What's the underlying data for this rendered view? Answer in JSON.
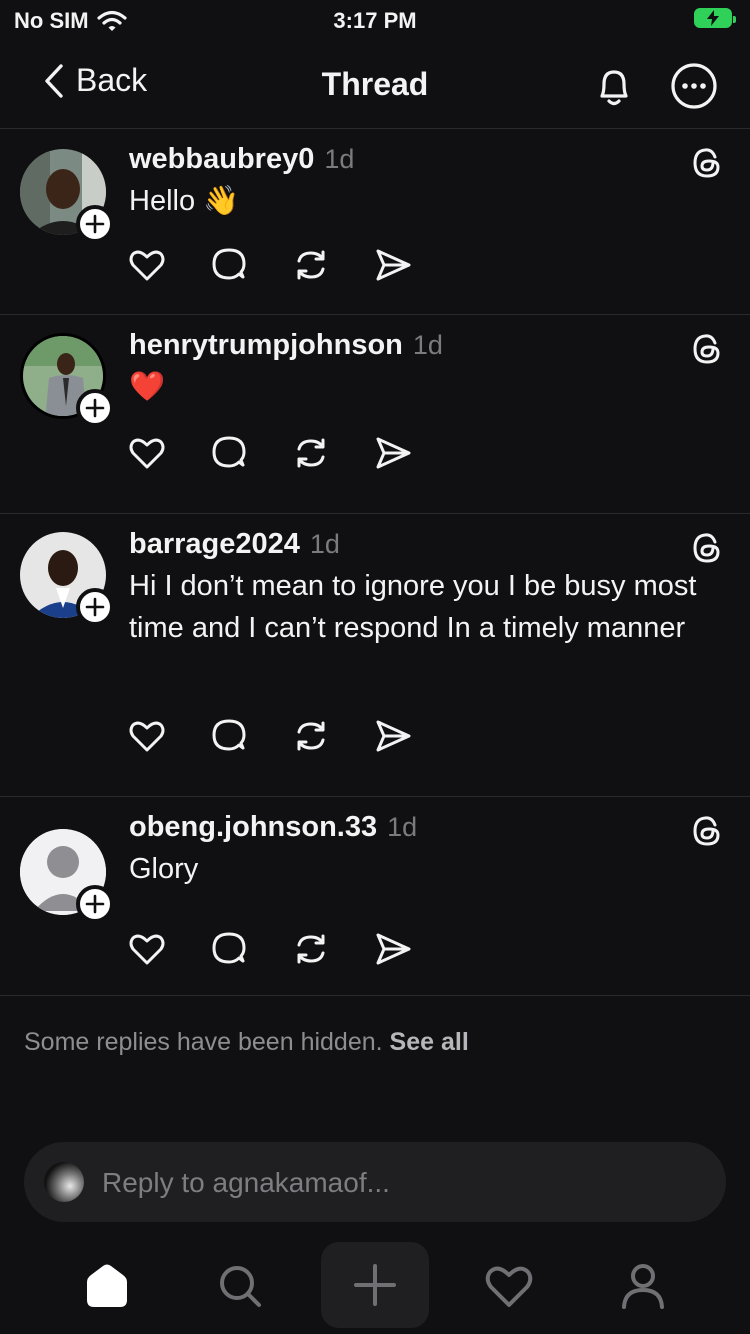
{
  "status_bar": {
    "carrier": "No SIM",
    "time": "3:17 PM"
  },
  "nav": {
    "back_label": "Back",
    "title": "Thread"
  },
  "replies": [
    {
      "username": "webbaubrey0",
      "time": "1d",
      "text": "Hello 👋"
    },
    {
      "username": "henrytrumpjohnson",
      "time": "1d",
      "text": "❤️"
    },
    {
      "username": "barrage2024",
      "time": "1d",
      "text": "Hi I don’t mean to ignore you I be busy most time and I can’t respond In a timely manner"
    },
    {
      "username": "obeng.johnson.33",
      "time": "1d",
      "text": "Glory"
    }
  ],
  "hidden_notice": {
    "text": "Some replies have been hidden.",
    "link": "See all"
  },
  "reply_box": {
    "placeholder": "Reply to agnakamaof..."
  },
  "colors": {
    "background": "#101012",
    "battery": "#2fd158",
    "divider": "#2a2a2d"
  }
}
